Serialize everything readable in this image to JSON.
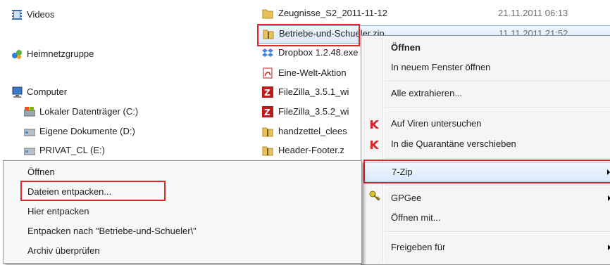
{
  "nav": {
    "videos": "Videos",
    "homegroup": "Heimnetzgruppe",
    "computer": "Computer",
    "drive_c": "Lokaler Datenträger (C:)",
    "drive_d": "Eigene Dokumente (D:)",
    "drive_e": "PRIVAT_CL (E:)"
  },
  "files": [
    {
      "name": "Zeugnisse_S2_2011-11-12",
      "date": "21.11.2011 06:13",
      "icon": "folder-icon"
    },
    {
      "name": "Betriebe-und-Schueler.zip",
      "date": "11.11.2011 21:52",
      "icon": "zip-folder-icon"
    },
    {
      "name": "Dropbox 1.2.48.exe",
      "icon": "dropbox-icon"
    },
    {
      "name": "Eine-Welt-Aktion",
      "icon": "pdf-icon"
    },
    {
      "name": "FileZilla_3.5.1_wi",
      "icon": "filezilla-icon"
    },
    {
      "name": "FileZilla_3.5.2_wi",
      "icon": "filezilla-icon"
    },
    {
      "name": "handzettel_clees",
      "icon": "zip-folder-icon"
    },
    {
      "name": "Header-Footer.z",
      "icon": "zip-folder-icon"
    }
  ],
  "context_menu": {
    "open": "Öffnen",
    "open_new_window": "In neuem Fenster öffnen",
    "extract_all": "Alle extrahieren...",
    "scan_viruses": "Auf Viren untersuchen",
    "quarantine": "In die Quarantäne verschieben",
    "seven_zip": "7-Zip",
    "gpgee": "GPGee",
    "open_with": "Öffnen mit...",
    "share_with": "Freigeben für"
  },
  "seven_zip_submenu": {
    "open": "Öffnen",
    "extract_files": "Dateien entpacken...",
    "extract_here": "Hier entpacken",
    "extract_to": "Entpacken nach \"Betriebe-und-Schueler\\\"",
    "test_archive": "Archiv überprüfen"
  },
  "colors": {
    "highlight_border": "#e0262b",
    "selection": "#dcebfc",
    "folder": "#e8c15a",
    "kaspersky": "#d8232a",
    "filezilla": "#bf1a1a"
  }
}
